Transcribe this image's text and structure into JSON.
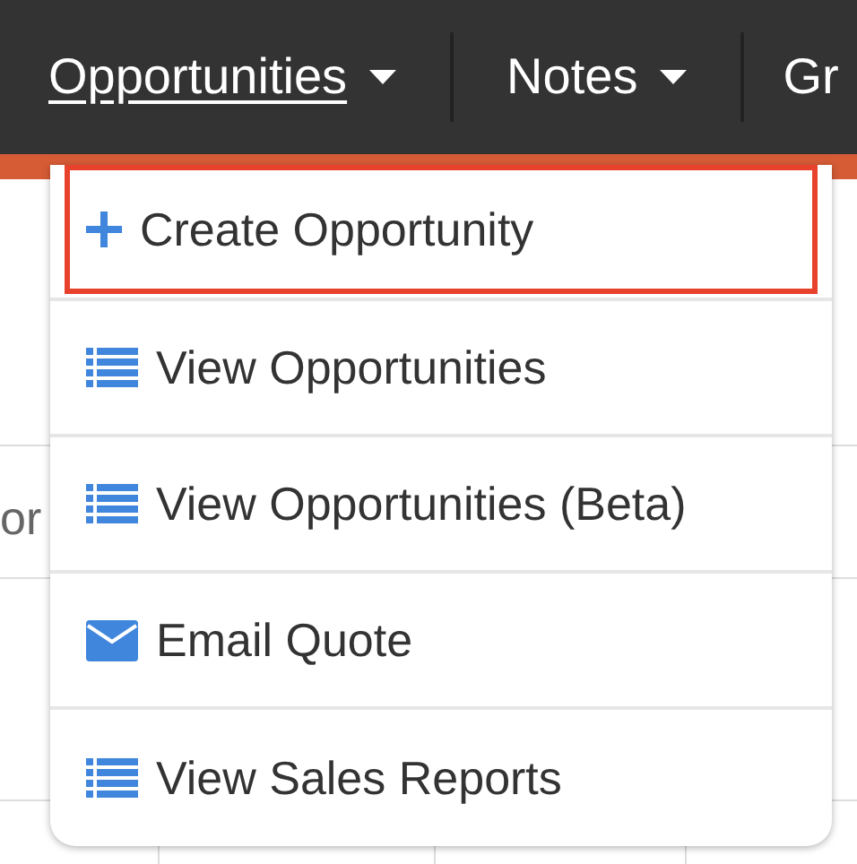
{
  "nav": [
    {
      "label": "Opportunities",
      "selected": true,
      "dropdown": true
    },
    {
      "label": "Notes",
      "selected": false,
      "dropdown": true
    },
    {
      "label": "Gr",
      "selected": false,
      "dropdown": false
    }
  ],
  "background_text": "or",
  "menu": [
    {
      "kind": "create",
      "label": "Create Opportunity",
      "highlighted": true
    },
    {
      "kind": "list",
      "label": "View Opportunities",
      "highlighted": false
    },
    {
      "kind": "list",
      "label": "View Opportunities (Beta)",
      "highlighted": false
    },
    {
      "kind": "email",
      "label": "Email Quote",
      "highlighted": false
    },
    {
      "kind": "list",
      "label": "View Sales Reports",
      "highlighted": false
    }
  ]
}
